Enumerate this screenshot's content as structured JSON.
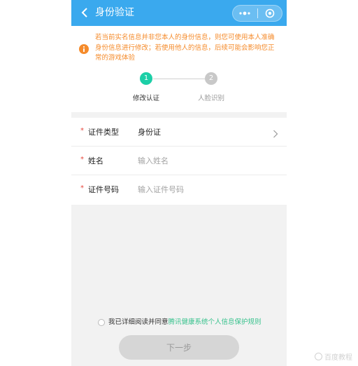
{
  "header": {
    "title": "身份验证",
    "back_icon": "chevron-left-icon",
    "more_icon": "more-dots-icon",
    "close_icon": "target-circle-icon",
    "bg_color": "#3aa9ee"
  },
  "notice": {
    "icon": "info-icon",
    "text": "若当前实名信息并非您本人的身份信息，则您可使用本人准确身份信息进行修改；若使用他人的信息，后续可能会影响您正常的游戏体验",
    "color": "#f58b2b"
  },
  "steps": [
    {
      "number": "1",
      "label": "修改认证",
      "active": true,
      "color": "#1ccfa7"
    },
    {
      "number": "2",
      "label": "人脸识别",
      "active": false,
      "color": "#c8c8c8"
    }
  ],
  "form": {
    "rows": [
      {
        "label": "证件类型",
        "value": "身份证",
        "required": "*"
      },
      {
        "label": "姓名",
        "placeholder": "输入姓名",
        "required": "*"
      },
      {
        "label": "证件号码",
        "placeholder": "输入证件号码",
        "required": "*"
      }
    ]
  },
  "agreement": {
    "prefix": "我已详细阅读并同意",
    "link": "腾讯健康系统个人信息保护规则",
    "link_color": "#38c28d"
  },
  "next_button": {
    "label": "下一步"
  },
  "watermark": {
    "text": "百度教程"
  }
}
